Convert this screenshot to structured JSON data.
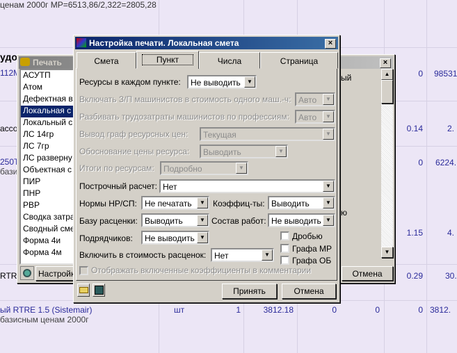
{
  "background": {
    "header_text": "ценам 2000г МР=6513,86/2,322=2805,28",
    "left_fragments": [
      "удо",
      "112М",
      "ассо",
      "250Т:",
      "базис",
      "RTRE"
    ],
    "bottom_row": {
      "name": "ый RTRE 1.5 (Sistemair)",
      "subtext": "базисным ценам 2000г",
      "unit": "шт",
      "qty": "1",
      "price": "3812.18",
      "c1": "0",
      "c2": "0",
      "c3": "0",
      "total": "3812."
    },
    "right_values": [
      {
        "a": "0",
        "b": "98531."
      },
      {
        "a": "0.14",
        "b": "2."
      },
      {
        "a": "0",
        "b": "6224."
      },
      {
        "a": "1.15",
        "b": "4."
      },
      {
        "a": "0.29",
        "b": "30."
      }
    ]
  },
  "print_window": {
    "title": "Печать",
    "list": [
      "АСУТП",
      "Атом",
      "Дефектная в",
      "Локальная с",
      "Локальный с",
      "ЛС 14гр",
      "ЛС 7гр",
      "ЛС разверну",
      "Объектная с",
      "ПИР",
      "ПНР",
      "РВР",
      "Сводка затра",
      "Сводный сме",
      "Форма 4и",
      "Форма 4м"
    ],
    "selected_index": 3,
    "fragments": [
      "ый",
      "ю"
    ],
    "settings_button": "Настройки",
    "cancel_button": "Отмена"
  },
  "dialog": {
    "title": "Настройка печати. Локальная смета",
    "tabs": [
      "Смета",
      "Пункт",
      "Числа",
      "Страница"
    ],
    "active_tab": "Пункт",
    "fields": {
      "resources_label": "Ресурсы в каждом пункте:",
      "resources_value": "Не выводить",
      "include_zp_label": "Включать З/П машинистов в стоимость одного маш.-ч:",
      "include_zp_value": "Авто",
      "split_label": "Разбивать трудозатраты машинистов по профессиям:",
      "split_value": "Авто",
      "price_cols_label": "Вывод граф ресурсных цен:",
      "price_cols_value": "Текущая",
      "justification_label": "Обоснование цены ресурса:",
      "justification_value": "Выводить",
      "totals_label": "Итоги по ресурсам:",
      "totals_value": "Подробно",
      "line_calc_label": "Построчный расчет:",
      "line_calc_value": "Нет",
      "norms_label": "Нормы НР/СП:",
      "norms_value": "Не печатать",
      "coef_label": "Коэффиц-ты:",
      "coef_value": "Выводить",
      "base_label": "Базу расценки:",
      "base_value": "Выводить",
      "works_label": "Состав работ:",
      "works_value": "Не выводить",
      "contractors_label": "Подрядчиков:",
      "contractors_value": "Не выводить",
      "include_cost_label": "Включить в стоимость расценок:",
      "include_cost_value": "Нет",
      "fraction_label": "Дробью",
      "col_mr_label": "Графа МР",
      "col_ob_label": "Графа ОБ",
      "show_coef_label": "Отображать включенные коэффициенты в комментарии"
    },
    "accept_button": "Принять",
    "cancel_button": "Отмена"
  }
}
